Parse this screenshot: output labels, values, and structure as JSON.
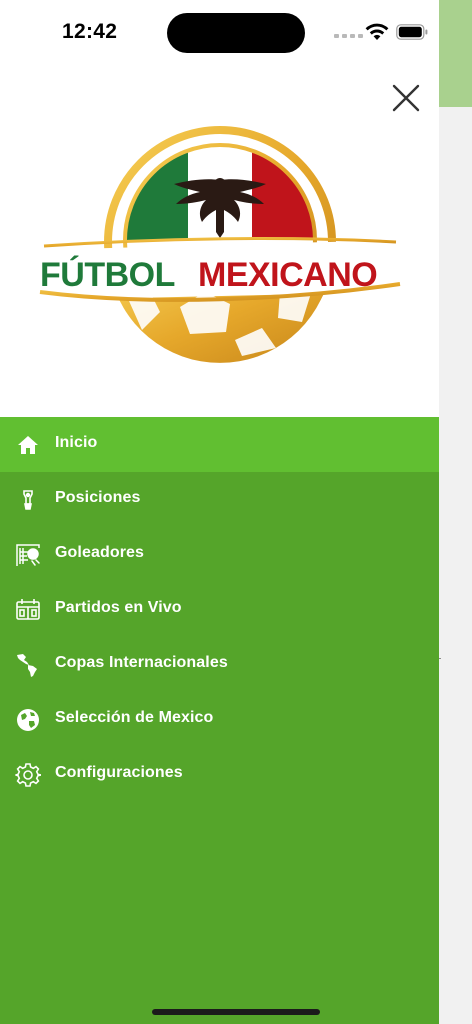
{
  "status_bar": {
    "time": "12:42"
  },
  "logo": {
    "text_part1": "FÚTBOL",
    "text_part2": "MEXICANO"
  },
  "colors": {
    "menu_bg": "#55a52a",
    "menu_active": "#61bf31",
    "mexico_green": "#1f7a3a",
    "mexico_red": "#c0141b",
    "gold": "#e6a82b"
  },
  "menu": {
    "items": [
      {
        "label": "Inicio",
        "icon": "home-icon",
        "active": true
      },
      {
        "label": "Posiciones",
        "icon": "trophy-icon",
        "active": false
      },
      {
        "label": "Goleadores",
        "icon": "goal-net-icon",
        "active": false
      },
      {
        "label": "Partidos en Vivo",
        "icon": "scoreboard-icon",
        "active": false
      },
      {
        "label": "Copas Internacionales",
        "icon": "americas-map-icon",
        "active": false
      },
      {
        "label": "Selección de Mexico",
        "icon": "globe-icon",
        "active": false
      },
      {
        "label": "Configuraciones",
        "icon": "gear-icon",
        "active": false
      }
    ]
  }
}
